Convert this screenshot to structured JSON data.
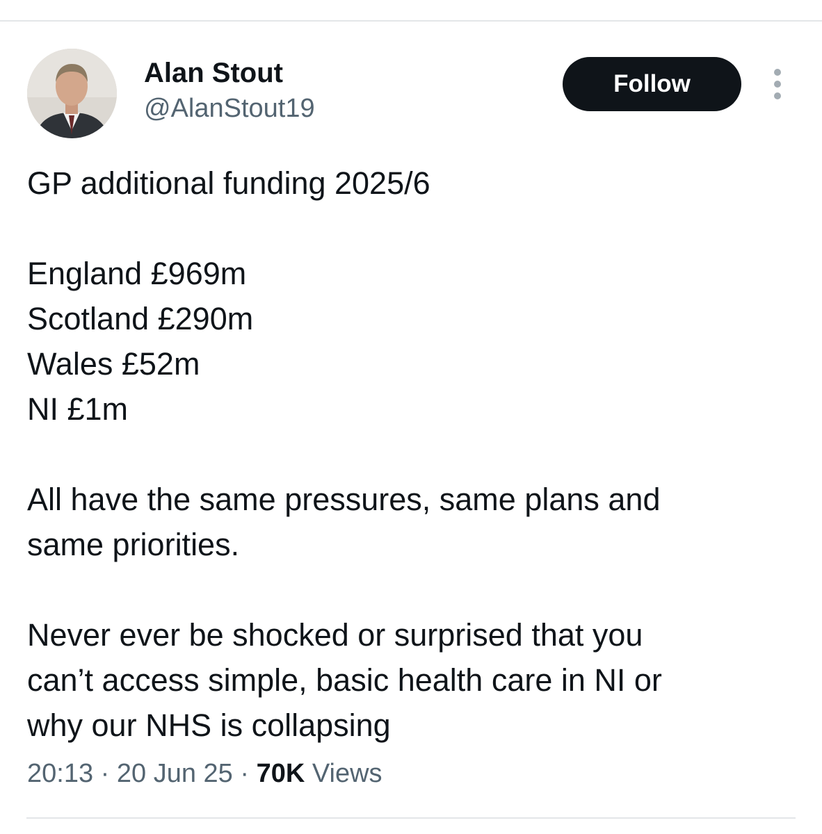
{
  "author": {
    "display_name": "Alan Stout",
    "handle": "@AlanStout19"
  },
  "actions": {
    "follow_label": "Follow",
    "more_icon": "more-vertical-icon"
  },
  "tweet": {
    "lines": {
      "l1": "GP additional funding 2025/6",
      "l2": "England £969m",
      "l3": "Scotland £290m",
      "l4": "Wales £52m",
      "l5": "NI £1m",
      "l6": "All have the same pressures, same plans and",
      "l7": "same priorities.",
      "l8": "Never ever be shocked or surprised that you",
      "l9": "can’t access simple, basic health care in NI or",
      "l10": "why our NHS is collapsing"
    }
  },
  "meta": {
    "time": "20:13",
    "separator": " · ",
    "date": "20 Jun 25",
    "views_count": "70K",
    "views_label": "Views"
  },
  "colors": {
    "text": "#0f1419",
    "secondary_text": "#536471",
    "follow_bg": "#0f1419",
    "divider": "#e3e6e8"
  }
}
